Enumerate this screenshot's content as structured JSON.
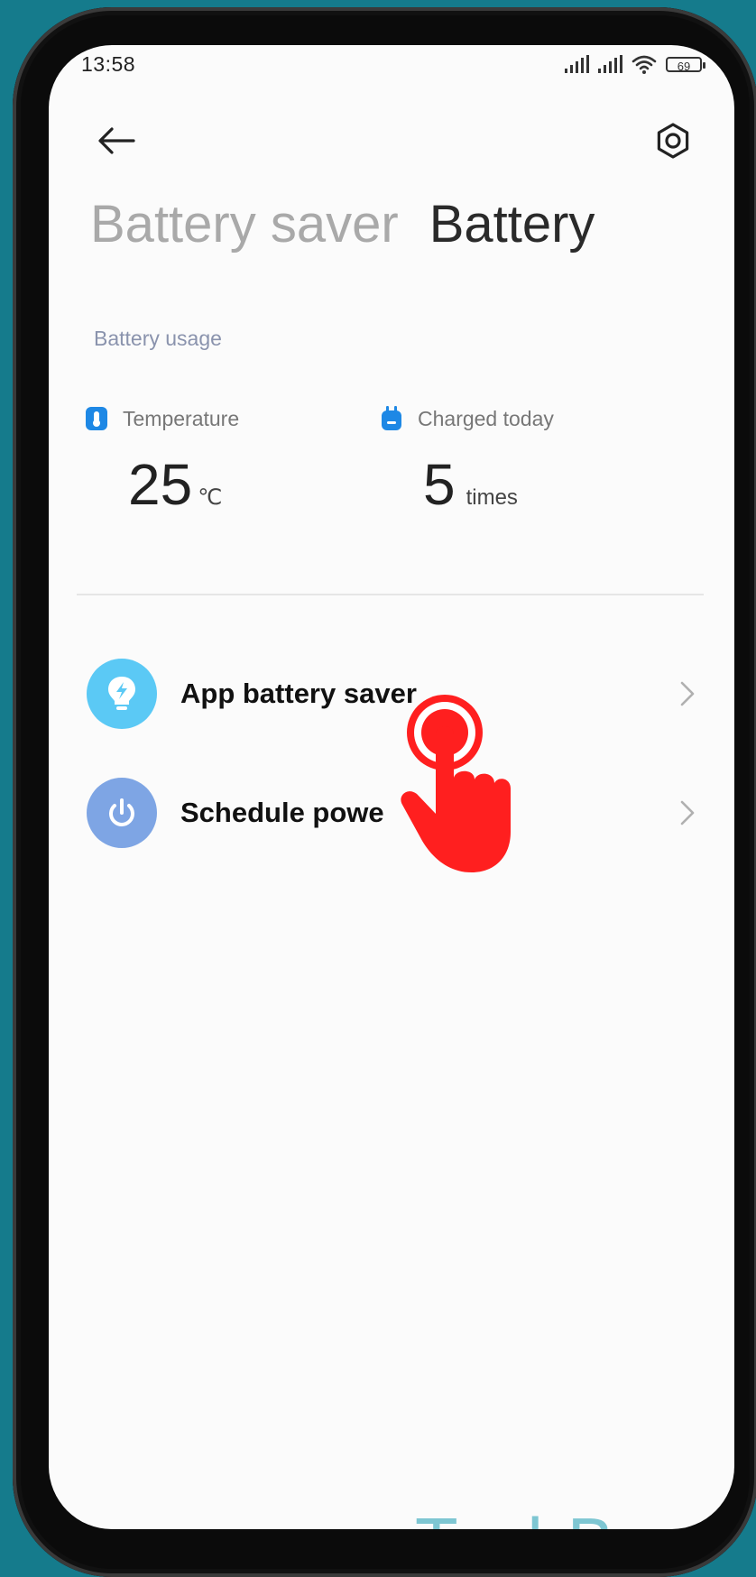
{
  "status": {
    "time": "13:58",
    "battery_level": "69"
  },
  "header": {
    "back_icon": "arrow-left-icon",
    "settings_icon": "gear-icon"
  },
  "tabs": [
    {
      "label": "Battery saver",
      "active": false
    },
    {
      "label": "Battery",
      "active": true
    }
  ],
  "usage": {
    "section_label": "Battery usage",
    "temperature": {
      "label": "Temperature",
      "value": "25",
      "unit": "℃",
      "icon": "thermometer-icon"
    },
    "charged": {
      "label": "Charged today",
      "value": "5",
      "unit": "times",
      "icon": "plug-icon"
    }
  },
  "menu": {
    "items": [
      {
        "label": "App battery saver",
        "icon": "lightbulb-bolt-icon",
        "icon_color": "#5bc9f5"
      },
      {
        "label": "Schedule powe",
        "icon": "power-icon",
        "icon_color": "#7ea5e4"
      }
    ]
  },
  "overlay": {
    "tap_icon": "tap-hand-icon",
    "tap_color": "#ff1f1f"
  },
  "watermark": {
    "text": "TechBone"
  }
}
